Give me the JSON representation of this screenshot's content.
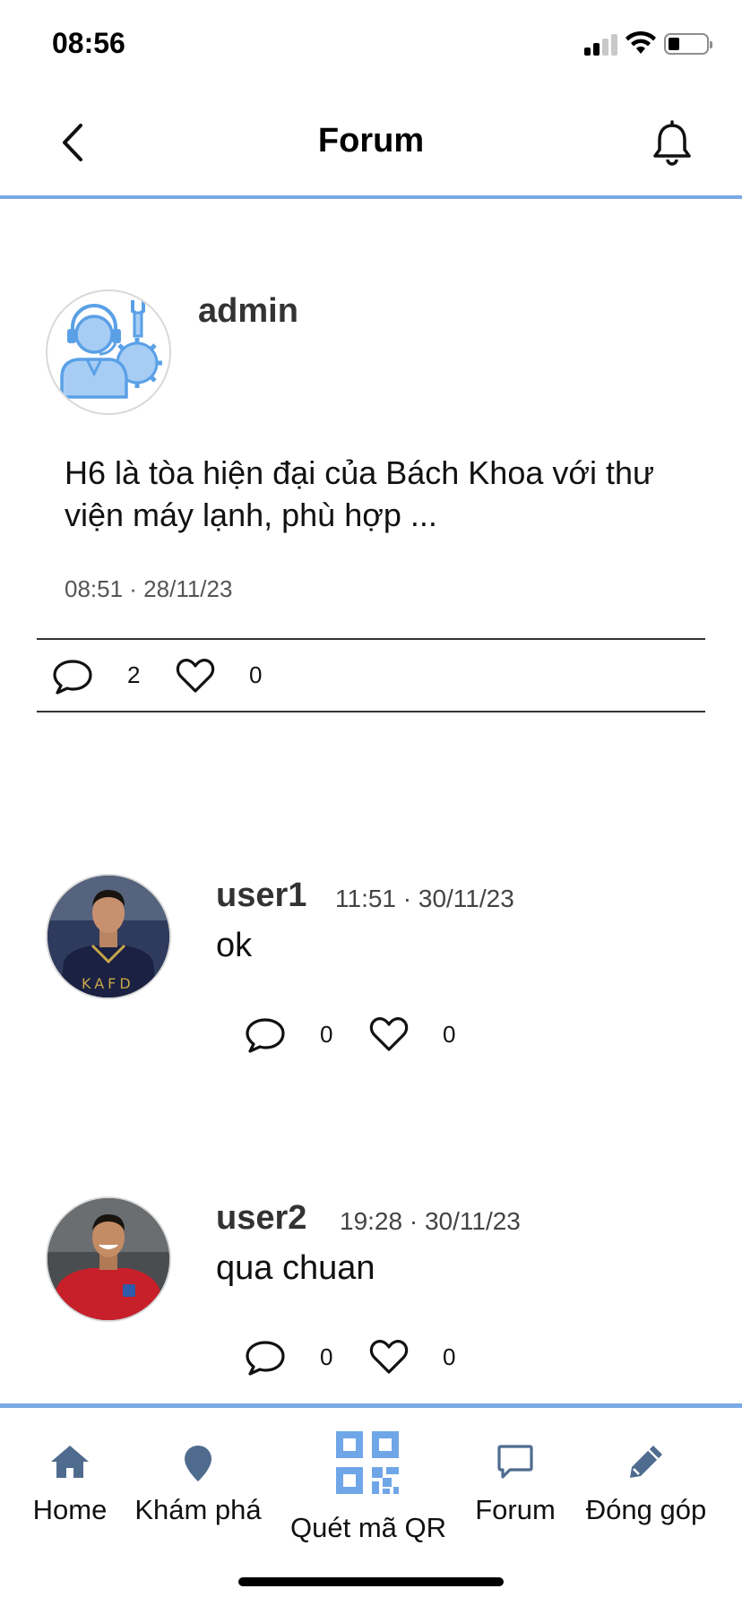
{
  "status_bar": {
    "time": "08:56"
  },
  "header": {
    "title": "Forum"
  },
  "post": {
    "author": "admin",
    "content": "H6 là tòa hiện đại của Bách Khoa với thư viện máy lạnh, phù hợp ...",
    "time": "08:51 · 28/11/23",
    "comment_count": "2",
    "like_count": "0"
  },
  "comments": [
    {
      "author": "user1",
      "time": "11:51 · 30/11/23",
      "text": "ok",
      "comment_count": "0",
      "like_count": "0"
    },
    {
      "author": "user2",
      "time": "19:28 · 30/11/23",
      "text": "qua chuan",
      "comment_count": "0",
      "like_count": "0"
    }
  ],
  "nav": {
    "home": "Home",
    "explore": "Khám phá",
    "scan_qr": "Quét mã QR",
    "forum": "Forum",
    "contribute": "Đóng góp"
  },
  "colors": {
    "accent": "#7aaae6",
    "nav_icon": "#4f6c8f",
    "qr_icon": "#6fa6e8"
  }
}
